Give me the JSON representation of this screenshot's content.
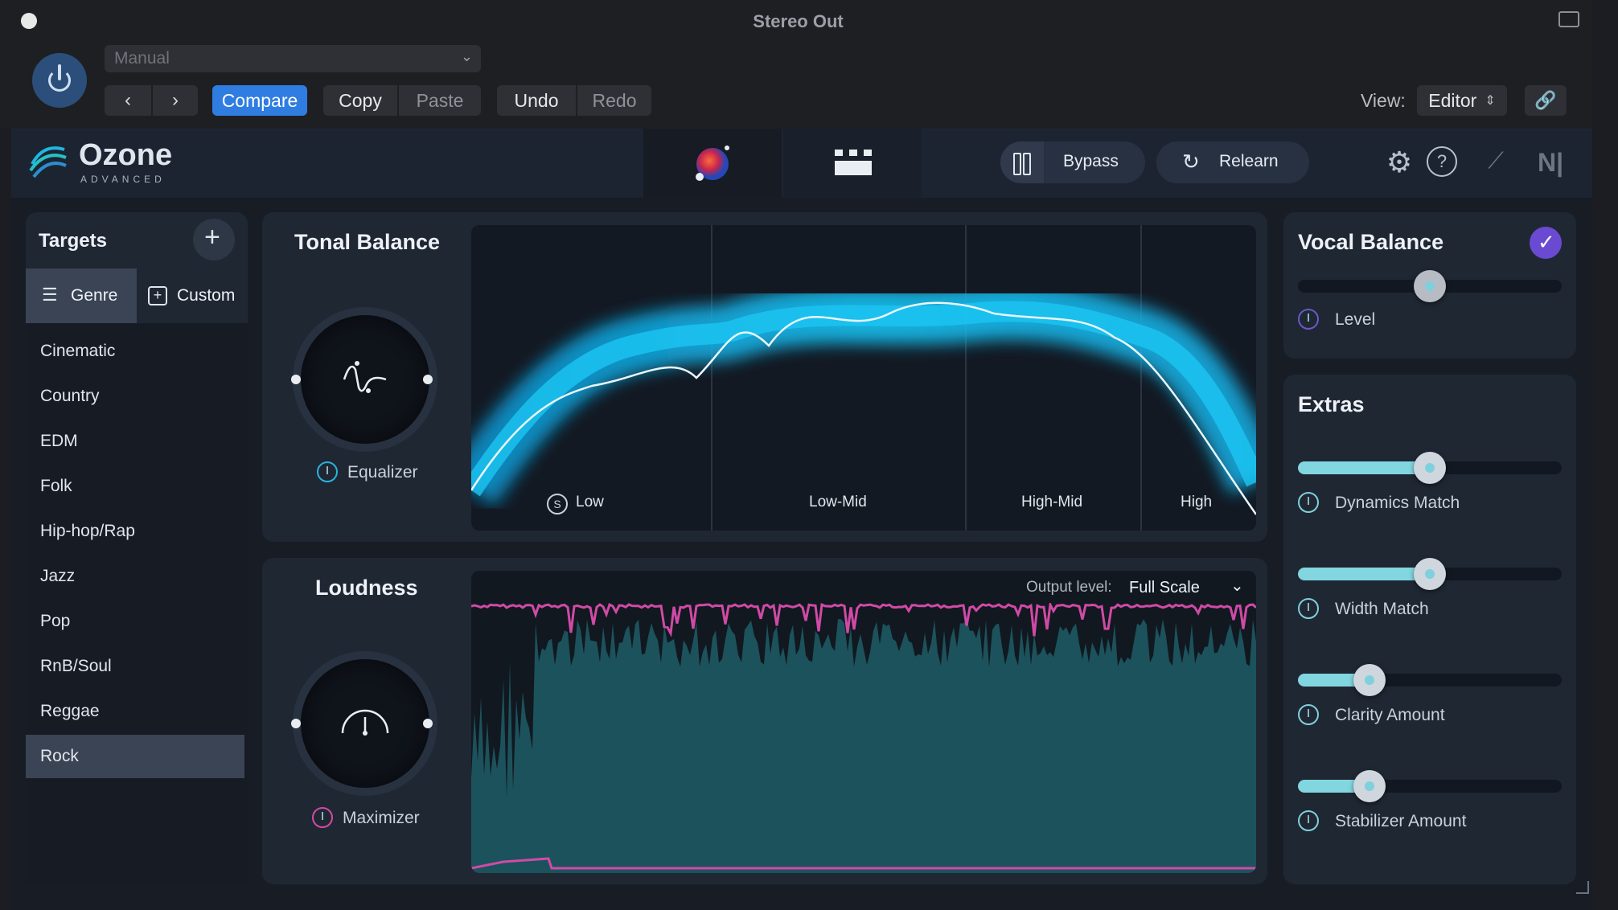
{
  "window": {
    "title": "Stereo Out"
  },
  "host": {
    "preset": "Manual",
    "compare": "Compare",
    "copy": "Copy",
    "paste": "Paste",
    "undo": "Undo",
    "redo": "Redo",
    "view_label": "View:",
    "view_value": "Editor"
  },
  "app": {
    "logo_name": "Ozone",
    "logo_sub": "ADVANCED",
    "bypass": "Bypass",
    "relearn": "Relearn"
  },
  "targets": {
    "title": "Targets",
    "tab_genre": "Genre",
    "tab_custom": "Custom",
    "items": [
      "Cinematic",
      "Country",
      "EDM",
      "Folk",
      "Hip-hop/Rap",
      "Jazz",
      "Pop",
      "RnB/Soul",
      "Reggae",
      "Rock"
    ],
    "selected": "Rock"
  },
  "tonal": {
    "title": "Tonal Balance",
    "knob_label": "Equalizer",
    "bands": [
      "Low",
      "Low-Mid",
      "High-Mid",
      "High"
    ],
    "solo_badge": "S"
  },
  "loudness": {
    "title": "Loudness",
    "knob_label": "Maximizer",
    "output_label": "Output level:",
    "output_value": "Full Scale"
  },
  "vocal": {
    "title": "Vocal Balance",
    "level_label": "Level",
    "level_value": 0.5
  },
  "extras": {
    "title": "Extras",
    "sliders": [
      {
        "label": "Dynamics Match",
        "value": 0.5
      },
      {
        "label": "Width Match",
        "value": 0.5
      },
      {
        "label": "Clarity Amount",
        "value": 0.27
      },
      {
        "label": "Stabilizer Amount",
        "value": 0.27
      }
    ]
  },
  "colors": {
    "accent_blue": "#2f7de1",
    "curve_cyan": "#15b8e6",
    "loud_pink": "#c2409a",
    "extras_fill": "#82d6e0"
  }
}
